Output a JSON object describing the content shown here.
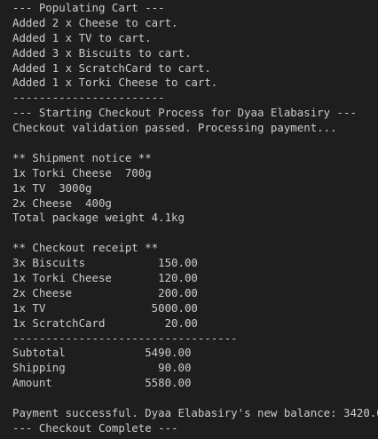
{
  "terminal": {
    "lines": [
      "--- Populating Cart ---",
      "Added 2 x Cheese to cart.",
      "Added 1 x TV to cart.",
      "Added 3 x Biscuits to cart.",
      "Added 1 x ScratchCard to cart.",
      "Added 1 x Torki Cheese to cart.",
      "-----------------------",
      "--- Starting Checkout Process for Dyaa Elabasiry ---",
      "Checkout validation passed. Processing payment...",
      "",
      "** Shipment notice **",
      "1x Torki Cheese  700g",
      "1x TV  3000g",
      "2x Cheese  400g",
      "Total package weight 4.1kg",
      "",
      "** Checkout receipt **",
      "3x Biscuits           150.00",
      "1x Torki Cheese       120.00",
      "2x Cheese             200.00",
      "1x TV                5000.00",
      "1x ScratchCard         20.00",
      "----------------------------------",
      "Subtotal            5490.00",
      "Shipping              90.00",
      "Amount              5580.00",
      "",
      "Payment successful. Dyaa Elabasiry's new balance: 3420.00",
      "--- Checkout Complete ---"
    ]
  }
}
